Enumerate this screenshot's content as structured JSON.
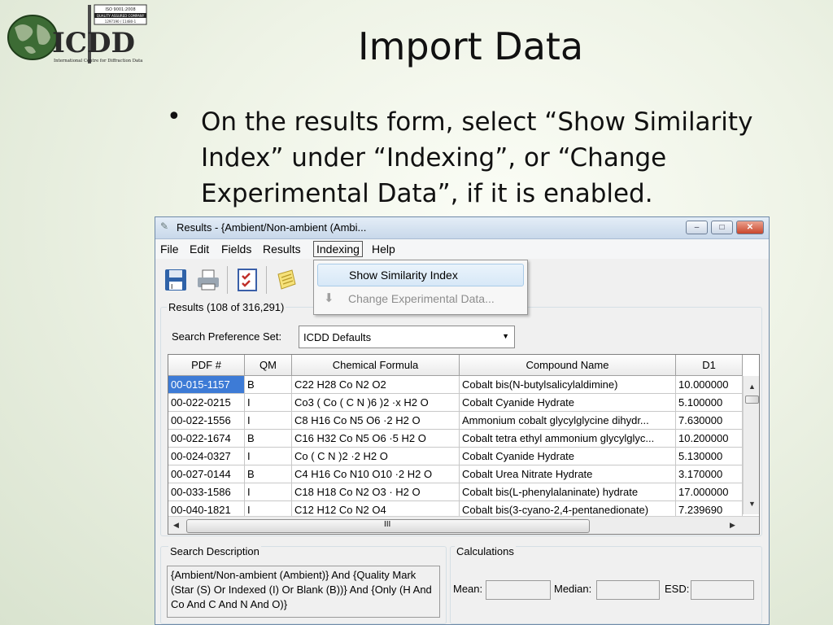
{
  "slide": {
    "logo": {
      "iso_text": "ISO 9001:2008",
      "quality_text": "QUALITY ASSURED COMPANY",
      "cert_text": "1297190 / 11480-1",
      "brand": "ICDD",
      "subtitle": "International Centre for Diffraction Data"
    },
    "title": "Import Data",
    "bullet": "On the results form, select “Show Similarity Index” under “Indexing”, or “Change Experimental Data”, if it is enabled."
  },
  "window": {
    "title": "Results - {Ambient/Non-ambient (Ambi...",
    "controls": {
      "minimize": "‒",
      "maximize": "□",
      "close": "✕"
    },
    "menu": [
      "File",
      "Edit",
      "Fields",
      "Results",
      "Indexing",
      "Help"
    ],
    "dropdown": {
      "items": [
        {
          "label": "Show Similarity Index",
          "enabled": true
        },
        {
          "label": "Change Experimental Data...",
          "enabled": false
        }
      ]
    },
    "toolbar_icons": [
      "save-icon",
      "print-icon",
      "checklist-icon",
      "notes-icon"
    ],
    "results_label": "Results (108 of 316,291)",
    "search_pref": {
      "label": "Search Preference Set:",
      "value": "ICDD Defaults"
    },
    "grid": {
      "columns": [
        "PDF #",
        "QM",
        "Chemical Formula",
        "Compound Name",
        "D1"
      ],
      "rows": [
        [
          "00-015-1157",
          "B",
          "C22 H28 Co N2 O2",
          "Cobalt bis(N-butylsalicylaldimine)",
          "10.000000"
        ],
        [
          "00-022-0215",
          "I",
          "Co3 ( Co ( C N )6 )2 ·x H2 O",
          "Cobalt Cyanide Hydrate",
          "5.100000"
        ],
        [
          "00-022-1556",
          "I",
          "C8 H16 Co N5 O6 ·2 H2 O",
          "Ammonium cobalt glycylglycine dihydr...",
          "7.630000"
        ],
        [
          "00-022-1674",
          "B",
          "C16 H32 Co N5 O6 ·5 H2 O",
          "Cobalt tetra ethyl ammonium glycylglyc...",
          "10.200000"
        ],
        [
          "00-024-0327",
          "I",
          "Co ( C N )2 ·2 H2 O",
          "Cobalt Cyanide Hydrate",
          "5.130000"
        ],
        [
          "00-027-0144",
          "B",
          "C4 H16 Co N10 O10 ·2 H2 O",
          "Cobalt Urea Nitrate Hydrate",
          "3.170000"
        ],
        [
          "00-033-1586",
          "I",
          "C18 H18 Co N2 O3 · H2 O",
          "Cobalt bis(L-phenylalaninate) hydrate",
          "17.000000"
        ],
        [
          "00-040-1821",
          "I",
          "C12 H12 Co N2 O4",
          "Cobalt bis(3-cyano-2,4-pentanedionate)",
          "7.239690"
        ]
      ],
      "selected_row": 0,
      "hscroll_center": "III"
    },
    "search_description": {
      "label": "Search Description",
      "text": "{Ambient/Non-ambient (Ambient)} And {Quality Mark (Star (S) Or Indexed (I) Or Blank (B))} And {Only (H And Co And C And N And O)}"
    },
    "calculations": {
      "label": "Calculations",
      "fields": [
        {
          "label": "Mean:",
          "value": ""
        },
        {
          "label": "Median:",
          "value": ""
        },
        {
          "label": "ESD:",
          "value": ""
        }
      ]
    }
  }
}
